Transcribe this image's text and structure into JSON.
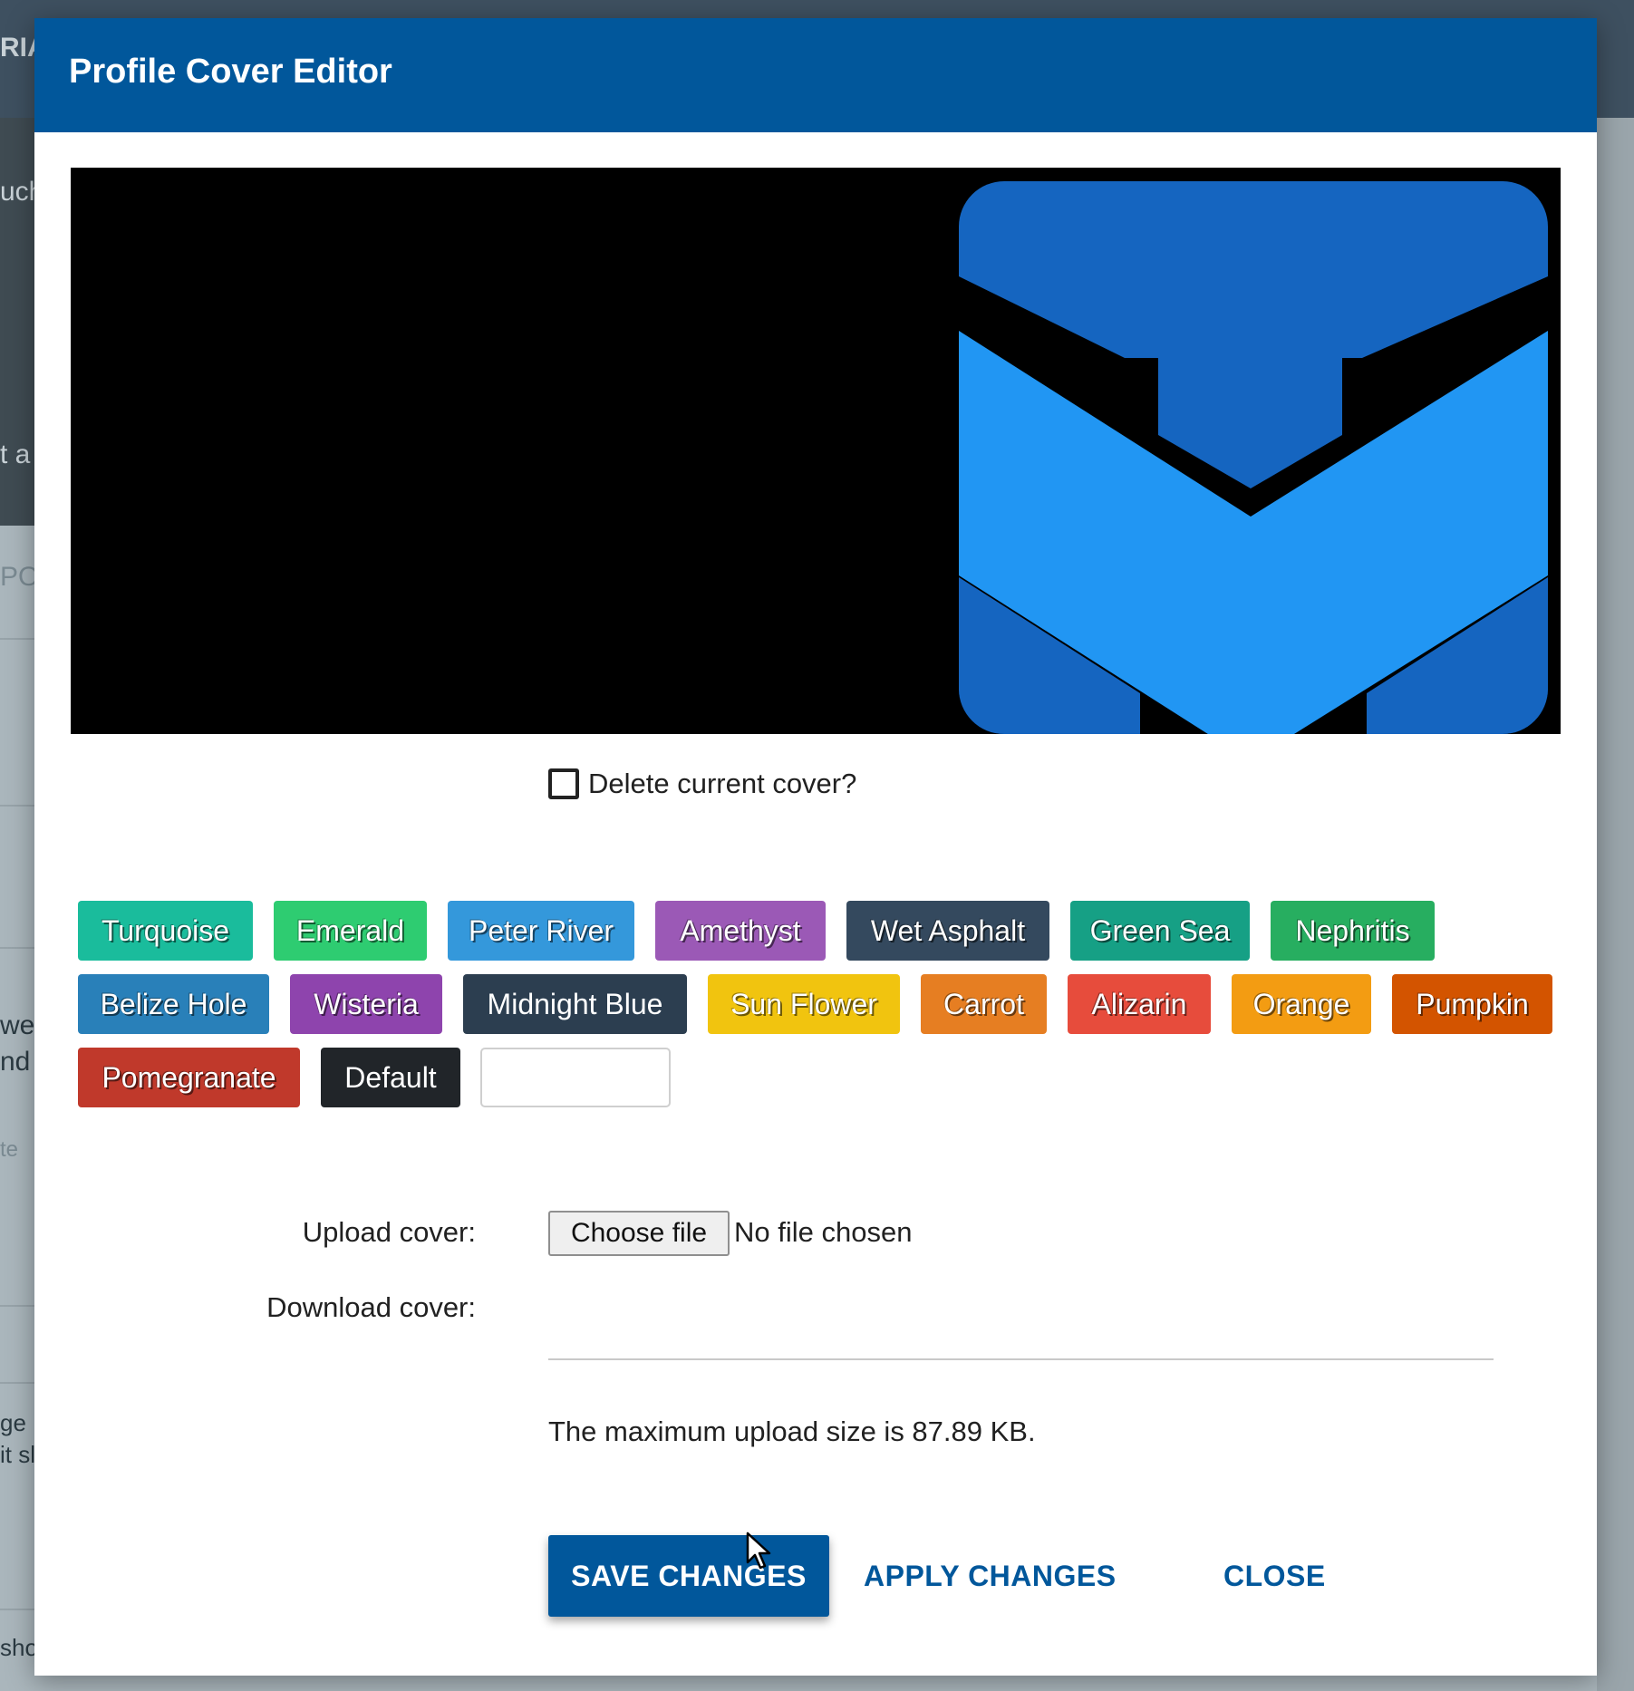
{
  "background": {
    "fragments": [
      "RIA",
      "uch",
      "t a",
      "POS",
      "we",
      "nd v",
      "te",
      "ge",
      "it sl",
      "show"
    ]
  },
  "modal": {
    "title": "Profile Cover Editor",
    "delete_label": "Delete current cover?",
    "delete_checked": false,
    "colors": [
      {
        "label": "Turquoise",
        "color": "#1abc9c"
      },
      {
        "label": "Emerald",
        "color": "#2ecc71"
      },
      {
        "label": "Peter River",
        "color": "#3498db"
      },
      {
        "label": "Amethyst",
        "color": "#9b59b6"
      },
      {
        "label": "Wet Asphalt",
        "color": "#34495e"
      },
      {
        "label": "Green Sea",
        "color": "#16a085"
      },
      {
        "label": "Nephritis",
        "color": "#27ae60"
      },
      {
        "label": "Belize Hole",
        "color": "#2980b9"
      },
      {
        "label": "Wisteria",
        "color": "#8e44ad"
      },
      {
        "label": "Midnight Blue",
        "color": "#2c3e50"
      },
      {
        "label": "Sun Flower",
        "color": "#f1c40f"
      },
      {
        "label": "Carrot",
        "color": "#e67e22"
      },
      {
        "label": "Alizarin",
        "color": "#e74c3c"
      },
      {
        "label": "Orange",
        "color": "#f39c12"
      },
      {
        "label": "Pumpkin",
        "color": "#d35400"
      },
      {
        "label": "Pomegranate",
        "color": "#c0392b"
      },
      {
        "label": "Default",
        "color": "#212529"
      }
    ],
    "custom_color_value": "",
    "upload_label": "Upload cover:",
    "choose_file_label": "Choose file",
    "no_file_text": "No file chosen",
    "download_label": "Download cover:",
    "download_value": "",
    "max_size_text": "The maximum upload size is 87.89 KB.",
    "save_label": "SAVE CHANGES",
    "apply_label": "APPLY CHANGES",
    "close_label": "CLOSE"
  },
  "theme": {
    "header_color": "#01579b",
    "logo_dark_blue": "#1565c0",
    "logo_light_blue": "#2196f3"
  }
}
